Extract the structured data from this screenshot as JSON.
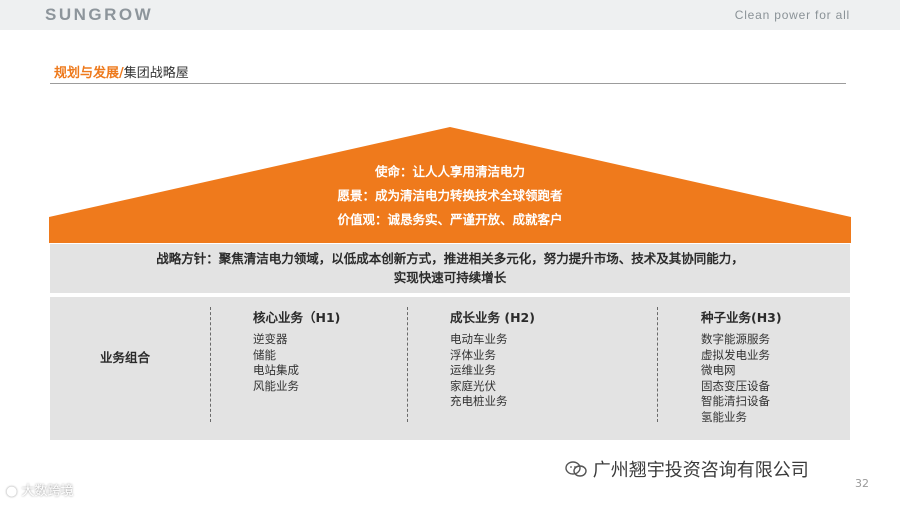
{
  "header": {
    "logo": "SUNGROW",
    "tagline": "Clean power for all"
  },
  "section": {
    "title_orange": "规划与发展/",
    "title_dark": "集团战略屋"
  },
  "roof": {
    "mission": "使命：让人人享用清洁电力",
    "vision": "愿景：成为清洁电力转换技术全球领跑者",
    "values": "价值观：诚恳务实、严谨开放、成就客户",
    "color": "#ef7a1c"
  },
  "strategy": {
    "line1": "战略方针：聚焦清洁电力领域，以低成本创新方式，推进相关多元化，努力提升市场、技术及其协同能力，",
    "line2": "实现快速可持续增长"
  },
  "business": {
    "label": "业务组合",
    "columns": [
      {
        "title": "核心业务（H1)",
        "items": [
          "逆变器",
          "储能",
          "电站集成",
          "风能业务"
        ]
      },
      {
        "title": "成长业务 (H2)",
        "items": [
          "电动车业务",
          "浮体业务",
          "运维业务",
          "家庭光伏",
          "充电桩业务"
        ]
      },
      {
        "title": "种子业务(H3)",
        "items": [
          "数字能源服务",
          "虚拟发电业务",
          "微电网",
          "固态变压设备",
          "智能清扫设备",
          "氢能业务"
        ]
      }
    ]
  },
  "footer": {
    "watermark_left": "大数跨境",
    "wechat_account": "广州翘宇投资咨询有限公司",
    "page": "32"
  }
}
